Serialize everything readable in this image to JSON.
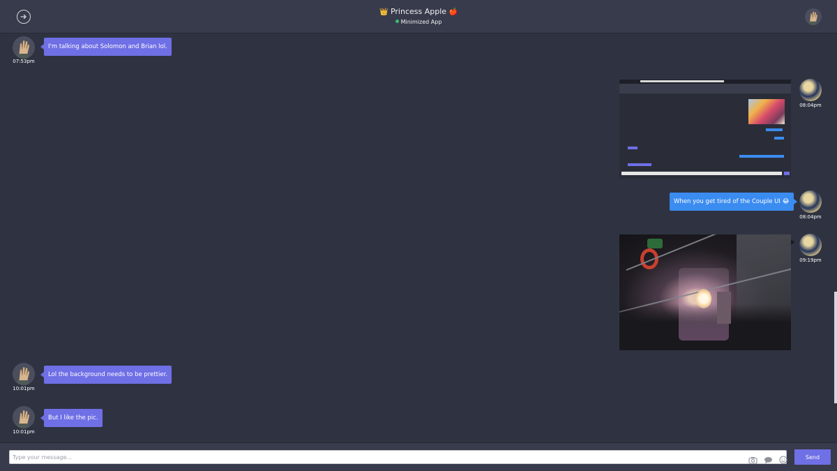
{
  "header": {
    "title": "Princess Apple",
    "title_prefix_emoji": "👑",
    "title_suffix_emoji": "🍎",
    "status": "Minimized App",
    "status_color": "#38c172"
  },
  "messages": [
    {
      "side": "received",
      "text": "I'm talking about Solomon and Brian lol.",
      "time": "07:53pm"
    },
    {
      "side": "sent",
      "type": "image",
      "image": "screenshot-thumbnail",
      "time": "08:04pm"
    },
    {
      "side": "sent",
      "text": "When you get tired of the Couple UI 😂",
      "time": "08:04pm"
    },
    {
      "side": "sent",
      "type": "image",
      "image": "candle-photo",
      "time": "09:19pm"
    },
    {
      "side": "received",
      "text": "Lol the background needs to be prettier.",
      "time": "10:01pm"
    },
    {
      "side": "received",
      "text": "But I like the pic.",
      "time": "10:01pm"
    }
  ],
  "composer": {
    "placeholder": "Type your message...",
    "value": "",
    "icons": [
      "camera-icon",
      "speech-bubble-icon",
      "smiley-icon"
    ],
    "send_label": "Send"
  },
  "colors": {
    "background": "#2f3341",
    "header": "#383b4b",
    "received_bubble": "#6f6fe6",
    "sent_bubble": "#3b8cf0",
    "send_button": "#6f6fe6"
  }
}
